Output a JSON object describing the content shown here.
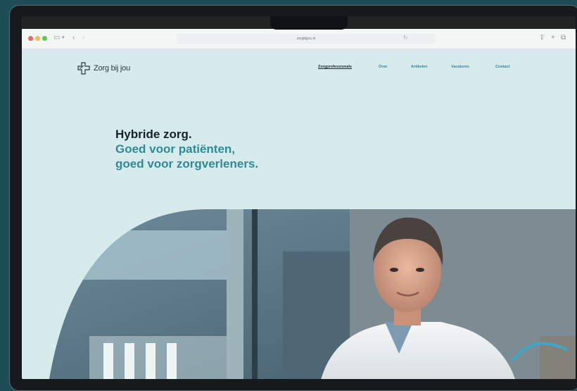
{
  "browser": {
    "url": "zorgbijjou.nl"
  },
  "site": {
    "logo_text": "Zorg bij jou",
    "nav": [
      "Zorgprofessionals",
      "Over",
      "Artikelen",
      "Vacatures",
      "Contact"
    ]
  },
  "hero": {
    "line1": "Hybride zorg.",
    "line2": "Goed voor patiënten,",
    "line3": "goed voor zorgverleners."
  },
  "colors": {
    "brand_teal": "#2f8a98",
    "page_bg": "#d7ebec",
    "backdrop": "#1f4d55"
  }
}
